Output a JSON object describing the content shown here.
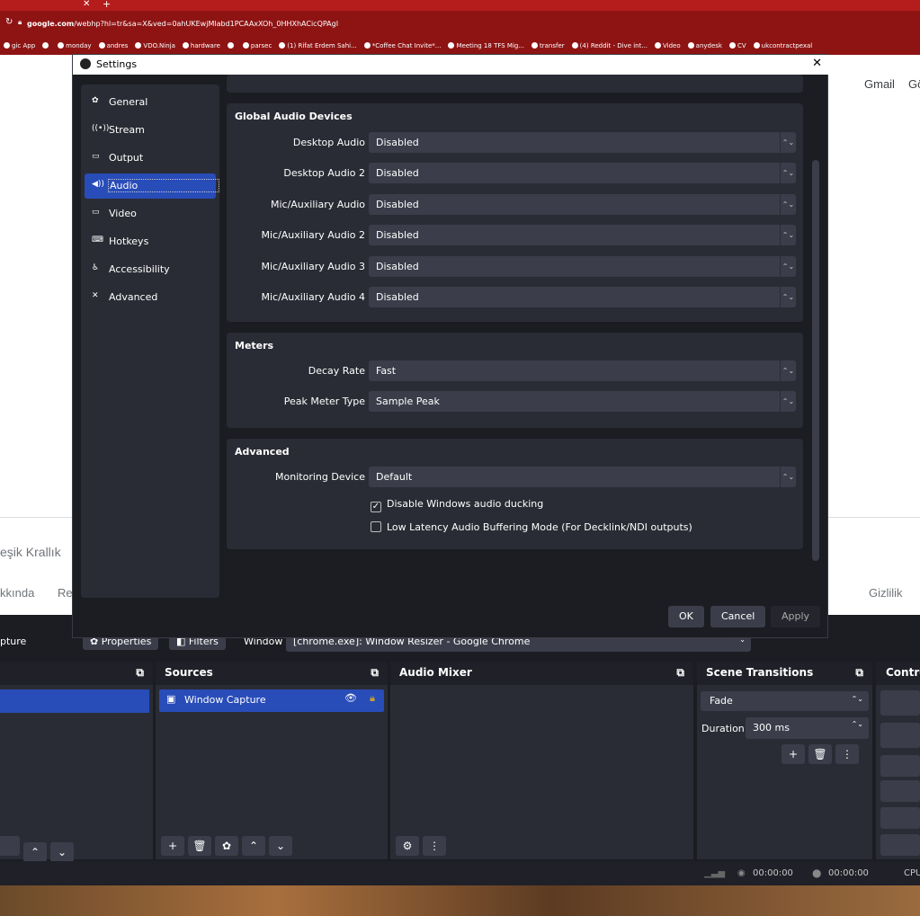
{
  "browser": {
    "url_host": "google.com",
    "url_rest": "/webhp?hl=tr&sa=X&ved=0ahUKEwjMlabd1PCAAxXOh_0HHXhACicQPAgI",
    "bookmarks": [
      "gic App",
      "",
      "monday",
      "andres",
      "VDO.Ninja",
      "hardware",
      "",
      "parsec",
      "(1) Rifat Erdem Sahi...",
      "*Coffee Chat Invite*...",
      "Meeting 18 TFS Mig...",
      "transfer",
      "(4) Reddit - Dive int...",
      "Video",
      "anydesk",
      "CV",
      "ukcontractpexal"
    ]
  },
  "google": {
    "gmail": "Gmail",
    "gorsel_partial": "Gö",
    "country": "eşik Krallık",
    "about": "kkında",
    "re_partial": "Re",
    "privacy": "Gizlilik"
  },
  "dialog": {
    "title": "Settings",
    "close": "✕",
    "nav": [
      {
        "label": "General",
        "icon": "✿"
      },
      {
        "label": "Stream",
        "icon": "((•))"
      },
      {
        "label": "Output",
        "icon": "▭"
      },
      {
        "label": "Audio",
        "icon": "◀))"
      },
      {
        "label": "Video",
        "icon": "▭"
      },
      {
        "label": "Hotkeys",
        "icon": "⌨"
      },
      {
        "label": "Accessibility",
        "icon": "♿"
      },
      {
        "label": "Advanced",
        "icon": "✕"
      }
    ],
    "global_audio": {
      "title": "Global Audio Devices",
      "rows": [
        {
          "label": "Desktop Audio",
          "value": "Disabled"
        },
        {
          "label": "Desktop Audio 2",
          "value": "Disabled"
        },
        {
          "label": "Mic/Auxiliary Audio",
          "value": "Disabled"
        },
        {
          "label": "Mic/Auxiliary Audio 2",
          "value": "Disabled"
        },
        {
          "label": "Mic/Auxiliary Audio 3",
          "value": "Disabled"
        },
        {
          "label": "Mic/Auxiliary Audio 4",
          "value": "Disabled"
        }
      ]
    },
    "meters": {
      "title": "Meters",
      "rows": [
        {
          "label": "Decay Rate",
          "value": "Fast"
        },
        {
          "label": "Peak Meter Type",
          "value": "Sample Peak"
        }
      ]
    },
    "advanced": {
      "title": "Advanced",
      "monitoring_label": "Monitoring Device",
      "monitoring_value": "Default",
      "ducking": "Disable Windows audio ducking",
      "ducking_checked": true,
      "low_latency": "Low Latency Audio Buffering Mode (For Decklink/NDI outputs)",
      "low_latency_checked": false
    },
    "buttons": {
      "ok": "OK",
      "cancel": "Cancel",
      "apply": "Apply"
    }
  },
  "obs": {
    "capture_partial": "pture",
    "properties": "Properties",
    "filters": "Filters",
    "window_label": "Window",
    "window_value": "[chrome.exe]: Window Resizer - Google Chrome",
    "sources_title": "Sources",
    "source_item": "Window Capture",
    "mixer_title": "Audio Mixer",
    "transitions_title": "Scene Transitions",
    "transition_value": "Fade",
    "duration_label": "Duration",
    "duration_value": "300 ms",
    "controls_partial": "Contro",
    "status_time1": "00:00:00",
    "status_time2": "00:00:00",
    "cpu_partial": "CPU"
  }
}
